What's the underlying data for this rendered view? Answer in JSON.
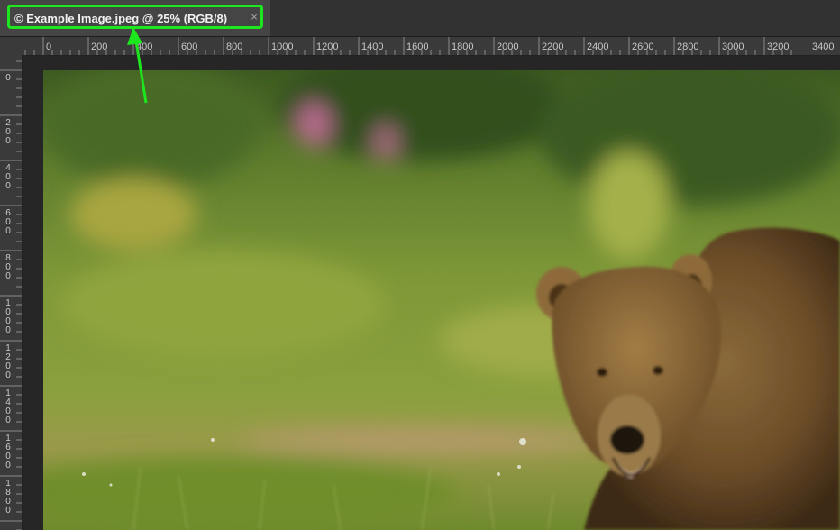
{
  "tab": {
    "title": "© Example Image.jpeg @ 25% (RGB/8)",
    "close_glyph": "×"
  },
  "rulers": {
    "horizontal_labels": [
      "0",
      "200",
      "400",
      "600",
      "800",
      "1000",
      "1200",
      "1400",
      "1600",
      "1800",
      "2000",
      "2200",
      "2400",
      "2600",
      "2800",
      "3000",
      "3200",
      "3400"
    ],
    "vertical_labels": [
      "0",
      "200",
      "400",
      "600",
      "800",
      "1000",
      "1200",
      "1400",
      "1600",
      "1800"
    ]
  },
  "image": {
    "subject": "brown-bear-in-green-meadow"
  },
  "annotation": {
    "highlight_color": "#1ee61e",
    "arrow_color": "#1ee61e"
  }
}
